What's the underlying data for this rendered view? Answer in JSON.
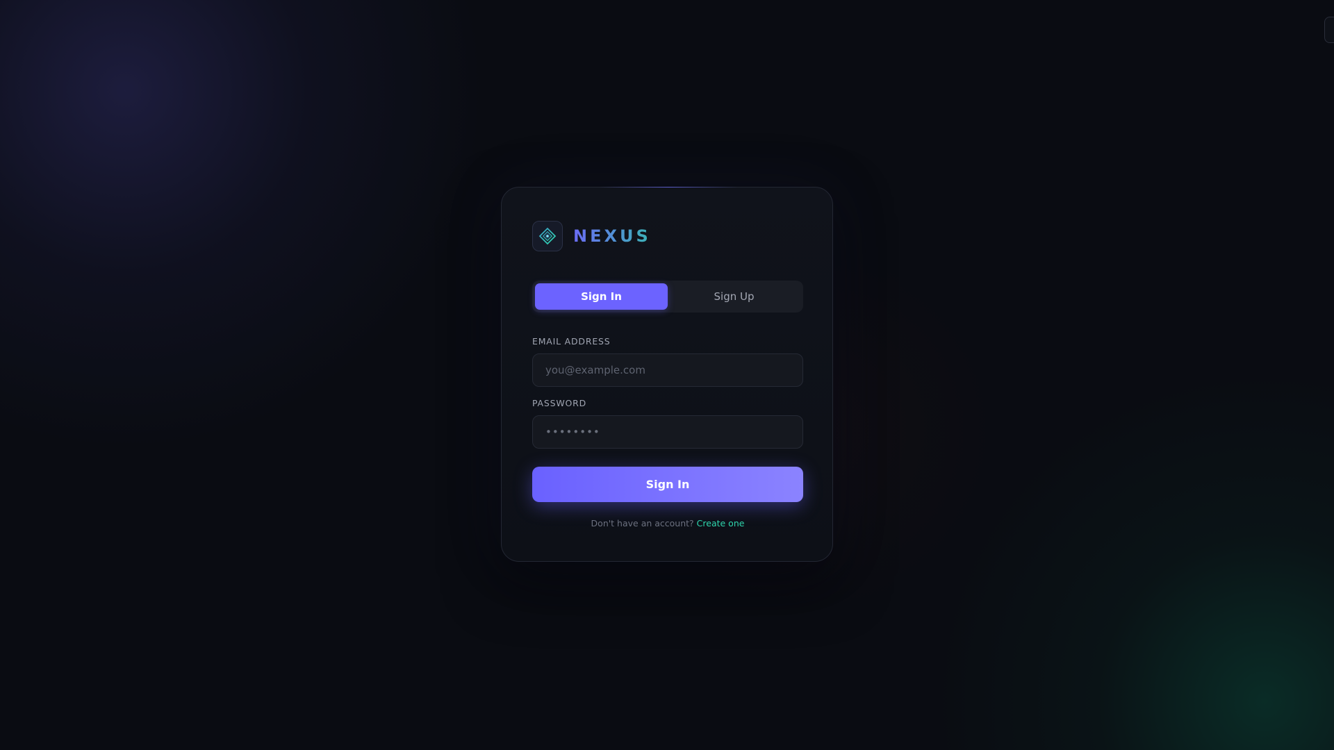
{
  "brand": {
    "name": "NEXUS",
    "logo_icon": "diamond-icon"
  },
  "tabs": [
    {
      "label": "Sign In",
      "active": true
    },
    {
      "label": "Sign Up",
      "active": false
    }
  ],
  "form": {
    "email": {
      "label": "EMAIL ADDRESS",
      "placeholder": "you@example.com",
      "value": ""
    },
    "password": {
      "label": "PASSWORD",
      "placeholder": "••••••••",
      "value": ""
    },
    "submit_label": "Sign In"
  },
  "footer": {
    "prompt": "Don't have an account?",
    "link_label": "Create one"
  },
  "colors": {
    "accent": "#6c63ff",
    "accent_light": "#8b83ff",
    "link": "#2fd6ad",
    "background": "#0a0c12"
  }
}
